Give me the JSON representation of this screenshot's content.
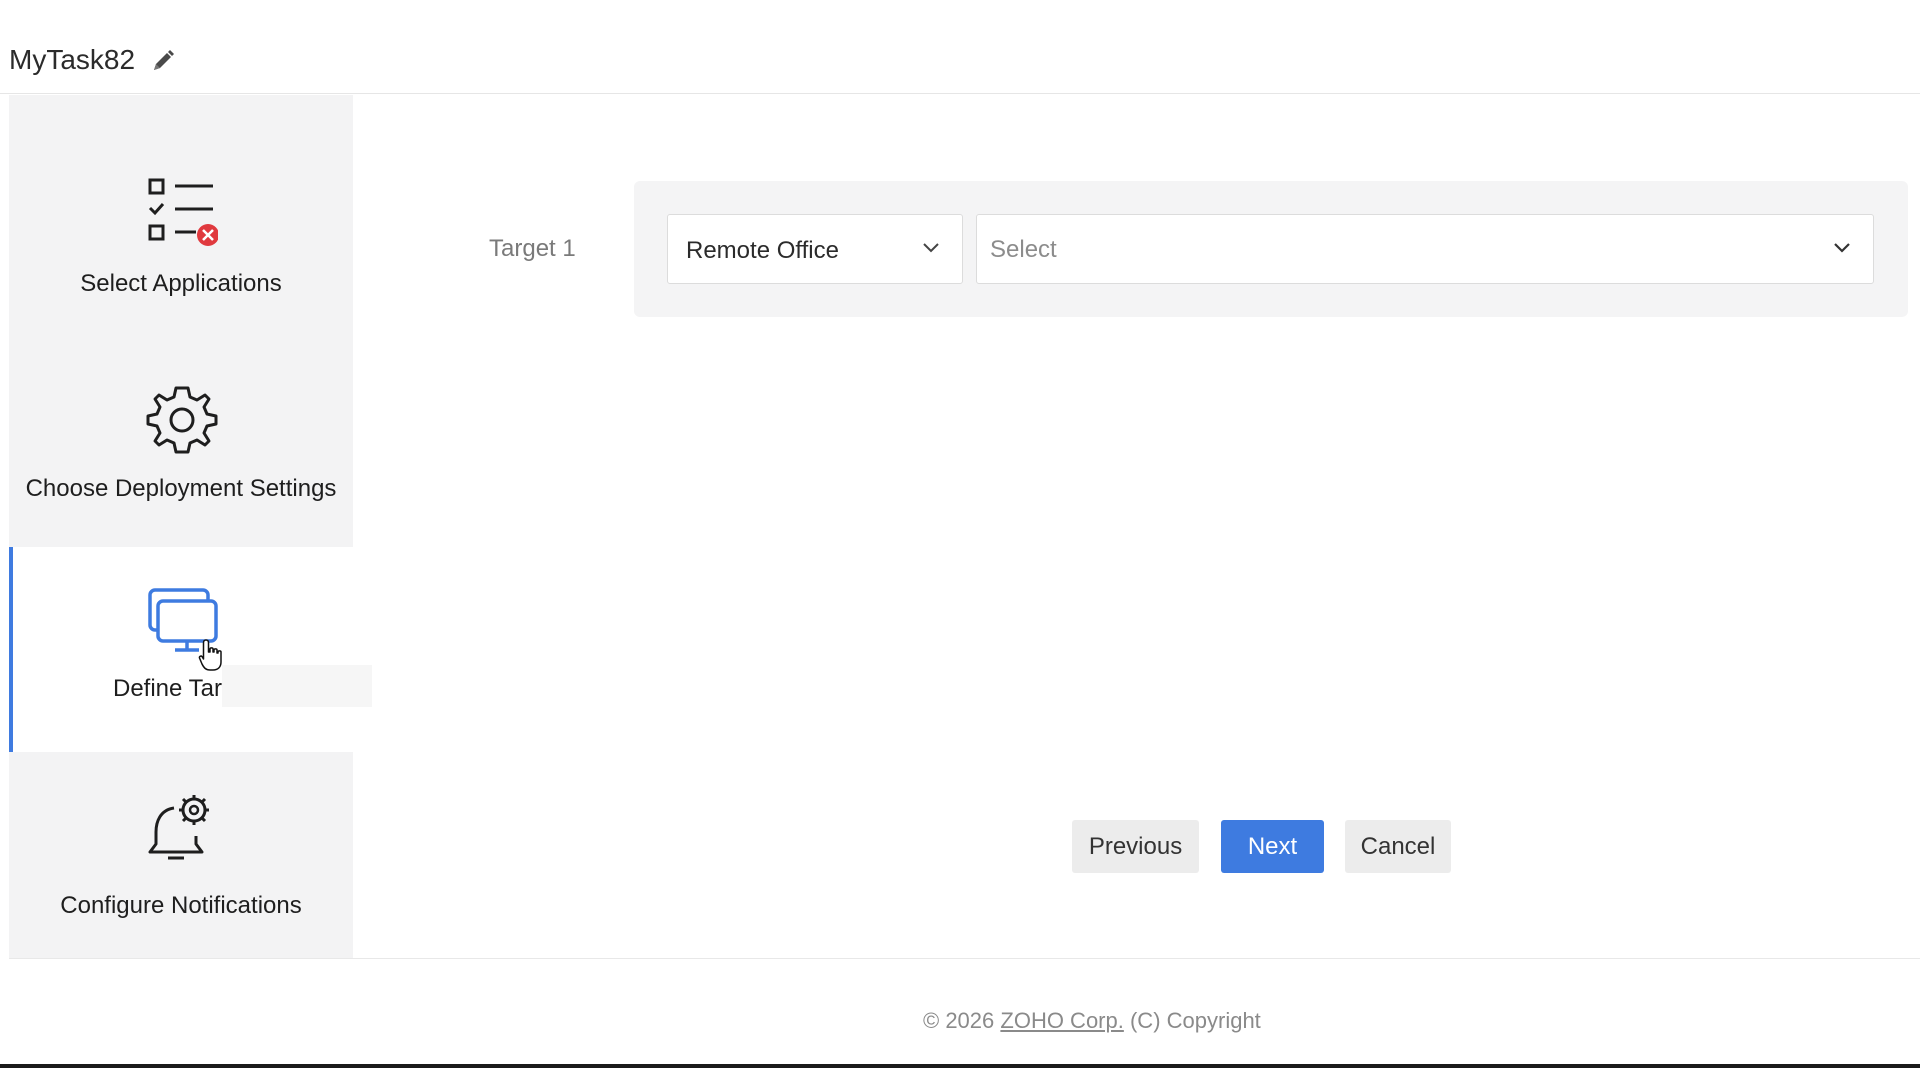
{
  "header": {
    "task_name": "MyTask82",
    "edit_icon": "pencil-icon"
  },
  "sidebar": {
    "steps": [
      {
        "label": "Select Applications",
        "icon": "checklist-icon",
        "active": false
      },
      {
        "label": "Choose Deployment Settings",
        "icon": "gear-icon",
        "active": false
      },
      {
        "label": "Define Tar",
        "icon": "monitors-icon",
        "active": true
      },
      {
        "label": "Configure Notifications",
        "icon": "bell-gear-icon",
        "active": false
      }
    ]
  },
  "main": {
    "target_label": "Target 1",
    "target_type_value": "Remote Office",
    "target_select_placeholder": "Select"
  },
  "buttons": {
    "previous": "Previous",
    "next": "Next",
    "cancel": "Cancel"
  },
  "footer": {
    "prefix": "© 2026",
    "link": "ZOHO Corp.",
    "suffix": "(C) Copyright"
  },
  "colors": {
    "accent": "#3e7be0",
    "error_badge": "#e0393e",
    "sidebar_bg": "#f3f3f4"
  }
}
